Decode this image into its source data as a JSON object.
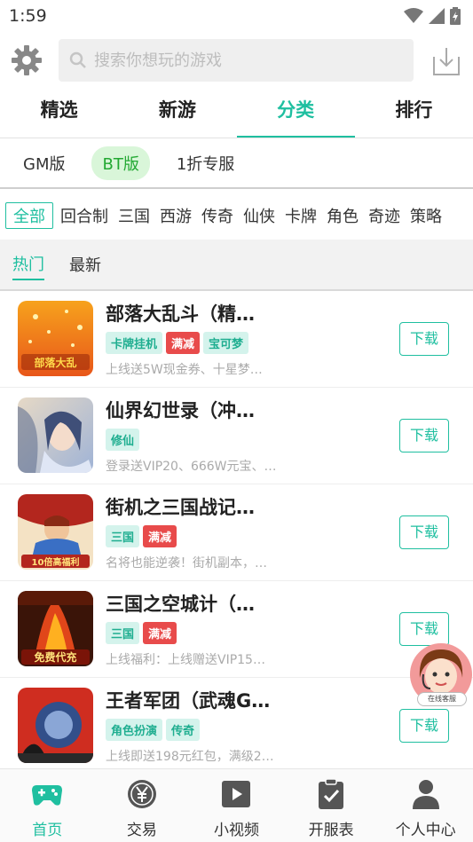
{
  "status_bar": {
    "time": "1:59"
  },
  "search": {
    "placeholder": "搜索你想玩的游戏"
  },
  "main_tabs": [
    {
      "label": "精选",
      "active": false
    },
    {
      "label": "新游",
      "active": false
    },
    {
      "label": "分类",
      "active": true
    },
    {
      "label": "排行",
      "active": false
    }
  ],
  "sub_tabs": [
    {
      "label": "GM版",
      "active": false
    },
    {
      "label": "BT版",
      "active": true
    },
    {
      "label": "1折专服",
      "active": false
    }
  ],
  "categories": [
    "全部",
    "回合制",
    "三国",
    "西游",
    "传奇",
    "仙侠",
    "卡牌",
    "角色",
    "奇迹",
    "策略"
  ],
  "filters": [
    {
      "label": "热门",
      "active": true
    },
    {
      "label": "最新",
      "active": false
    }
  ],
  "games": [
    {
      "title": "部落大乱斗（精…",
      "tags": [
        {
          "text": "卡牌挂机",
          "style": "green"
        },
        {
          "text": "满减",
          "style": "red"
        },
        {
          "text": "宝可梦",
          "style": "green"
        }
      ],
      "desc": "上线送5W现金券、十星梦…",
      "button": "下载",
      "icon_colors": [
        "#e8561a",
        "#f7a21c"
      ],
      "icon_caption": "部落大乱"
    },
    {
      "title": "仙界幻世录（冲…",
      "tags": [
        {
          "text": "修仙",
          "style": "green"
        }
      ],
      "desc": "登录送VIP20、666W元宝、…",
      "button": "下载",
      "icon_colors": [
        "#9fb3d6",
        "#e6d9c6"
      ],
      "icon_caption": ""
    },
    {
      "title": "街机之三国战记…",
      "tags": [
        {
          "text": "三国",
          "style": "green"
        },
        {
          "text": "满减",
          "style": "red"
        }
      ],
      "desc": "名将也能逆袭！街机副本，…",
      "button": "下载",
      "icon_colors": [
        "#b3261e",
        "#3a6fc4"
      ],
      "icon_caption": "10倍高福利"
    },
    {
      "title": "三国之空城计（…",
      "tags": [
        {
          "text": "三国",
          "style": "green"
        },
        {
          "text": "满减",
          "style": "red"
        }
      ],
      "desc": "上线福利：上线赠送VIP15…",
      "button": "下载",
      "icon_colors": [
        "#3a1408",
        "#e0461a"
      ],
      "icon_caption": "免费代充"
    },
    {
      "title": "王者军团（武魂G…",
      "tags": [
        {
          "text": "角色扮演",
          "style": "green"
        },
        {
          "text": "传奇",
          "style": "green"
        }
      ],
      "desc": "上线即送198元红包，满级2…",
      "button": "下载",
      "icon_colors": [
        "#cf2d20",
        "#324f8a"
      ],
      "icon_caption": ""
    }
  ],
  "customer_service": {
    "label": "在线客服"
  },
  "bottom_nav": [
    {
      "label": "首页",
      "icon": "gamepad-icon",
      "active": true
    },
    {
      "label": "交易",
      "icon": "yen-coin-icon",
      "active": false
    },
    {
      "label": "小视频",
      "icon": "play-icon",
      "active": false
    },
    {
      "label": "开服表",
      "icon": "clipboard-check-icon",
      "active": false
    },
    {
      "label": "个人中心",
      "icon": "person-icon",
      "active": false
    }
  ],
  "colors": {
    "accent": "#1fbfa0",
    "sale_red": "#e84b4b",
    "bt_green": "#22a832"
  }
}
